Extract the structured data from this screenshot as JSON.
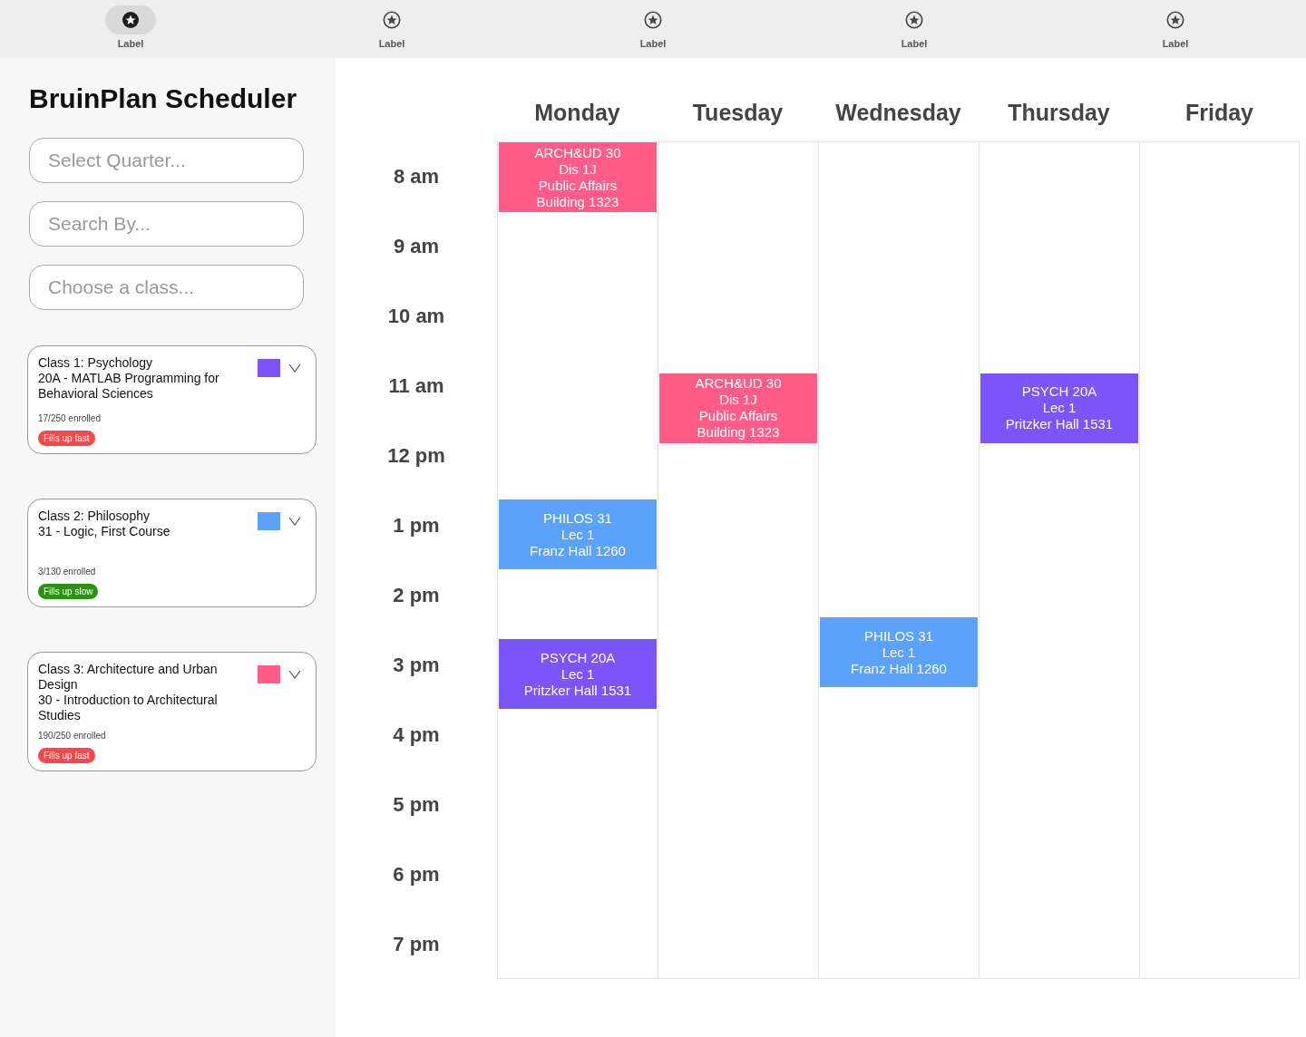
{
  "nav": [
    {
      "label": "Label",
      "selected": true
    },
    {
      "label": "Label",
      "selected": false
    },
    {
      "label": "Label",
      "selected": false
    },
    {
      "label": "Label",
      "selected": false
    },
    {
      "label": "Label",
      "selected": false
    }
  ],
  "sidebar": {
    "title": "BruinPlan Scheduler",
    "fields": [
      {
        "placeholder": "Select Quarter..."
      },
      {
        "placeholder": "Search By..."
      },
      {
        "placeholder": "Choose a class..."
      }
    ],
    "classes": [
      {
        "title": "Class 1: Psychology\n20A - MATLAB Programming for Behavioral Sciences",
        "enrolled": "17/250 enrolled",
        "tag": {
          "text": "Fills up fast",
          "color": "#f6474b"
        },
        "color": "#7b55f9",
        "expanded": false
      },
      {
        "title": "Class 2: Philosophy\n31 - Logic, First Course",
        "enrolled": "3/130 enrolled",
        "tag": {
          "text": "Fills up slow",
          "color": "#2a9412"
        },
        "color": "#5aa2fb",
        "expanded": false
      },
      {
        "title": "Class 3: Architecture and Urban Design\n30 - Introduction to Architectural Studies",
        "enrolled": "190/250 enrolled",
        "tag": {
          "text": "Fills up fast",
          "color": "#f6474b"
        },
        "color": "#ff5d87",
        "expanded": false
      }
    ]
  },
  "calendar": {
    "hours": [
      "8 am",
      "9 am",
      "10 am",
      "11 am",
      "12 pm",
      "1 pm",
      "2 pm",
      "3 pm",
      "4 pm",
      "5 pm",
      "6 pm",
      "7 pm"
    ],
    "days": [
      {
        "name": "Monday",
        "events": [
          {
            "lines": [
              "ARCH&UD 30",
              "Dis 1J",
              "Public Affairs",
              "Building 1323"
            ],
            "color": "#ff5d87"
          },
          {
            "lines": [
              "PHILOS 31",
              "Lec 1",
              "Franz Hall 1260"
            ],
            "color": "#5aa2fb"
          },
          {
            "lines": [
              "PSYCH 20A",
              "Lec 1",
              "Pritzker Hall 1531"
            ],
            "color": "#7b55f9"
          }
        ]
      },
      {
        "name": "Tuesday",
        "events": [
          {
            "lines": [
              "ARCH&UD 30",
              "Dis 1J",
              "Public Affairs",
              "Building 1323"
            ],
            "color": "#ff5d87"
          }
        ]
      },
      {
        "name": "Wednesday",
        "events": [
          {
            "lines": [
              "PHILOS 31",
              "Lec 1",
              "Franz Hall 1260"
            ],
            "color": "#5aa2fb"
          }
        ]
      },
      {
        "name": "Thursday",
        "events": [
          {
            "lines": [
              "PSYCH 20A",
              "Lec 1",
              "Pritzker Hall 1531"
            ],
            "color": "#7b55f9"
          }
        ]
      },
      {
        "name": "Friday"
      }
    ]
  }
}
